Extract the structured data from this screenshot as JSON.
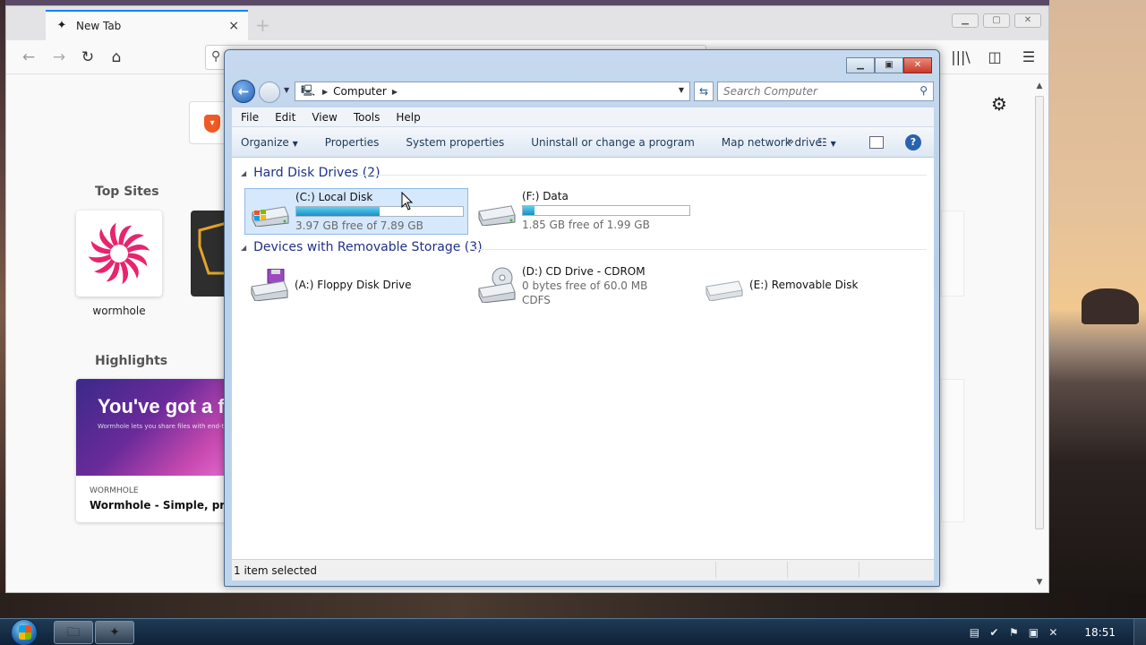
{
  "browser": {
    "tab_title": "New Tab",
    "tab_close": "×",
    "new_tab": "+",
    "top_sites_label": "Top Sites",
    "highlights_label": "Highlights",
    "top_sites": [
      {
        "name": "wormhole"
      }
    ],
    "highlight": {
      "image_headline": "You've got a f",
      "image_subtext": "Wormhole lets you share files with end-to-end encryption and a link that automatically",
      "source": "WORMHOLE",
      "title": "Wormhole - Simple, private"
    }
  },
  "explorer": {
    "address": {
      "crumb": "Computer"
    },
    "search": {
      "placeholder": "Search Computer"
    },
    "menu": [
      "File",
      "Edit",
      "View",
      "Tools",
      "Help"
    ],
    "commands": [
      "Organize",
      "Properties",
      "System properties",
      "Uninstall or change a program",
      "Map network drive"
    ],
    "more_commands": "»",
    "help_glyph": "?",
    "groups": [
      {
        "label": "Hard Disk Drives (2)",
        "drives": [
          {
            "name": "(C:) Local Disk",
            "free": "3.97 GB free of 7.89 GB",
            "used_fraction": 0.5,
            "selected": true
          },
          {
            "name": "(F:) Data",
            "free": "1.85 GB free of 1.99 GB",
            "used_fraction": 0.07,
            "selected": false
          }
        ]
      },
      {
        "label": "Devices with Removable Storage (3)",
        "drives": [
          {
            "name": "(A:) Floppy Disk Drive"
          },
          {
            "name": "(D:) CD Drive - CDROM",
            "free": "0 bytes free of 60.0 MB",
            "fs": "CDFS"
          },
          {
            "name": "(E:) Removable Disk"
          }
        ]
      }
    ],
    "status": "1 item selected"
  },
  "taskbar": {
    "clock": "18:51"
  },
  "colors": {
    "selection": "#d6e8fb",
    "group_header": "#1e3287",
    "bar_fill": "#26a0da",
    "taskbar": "#163050"
  }
}
